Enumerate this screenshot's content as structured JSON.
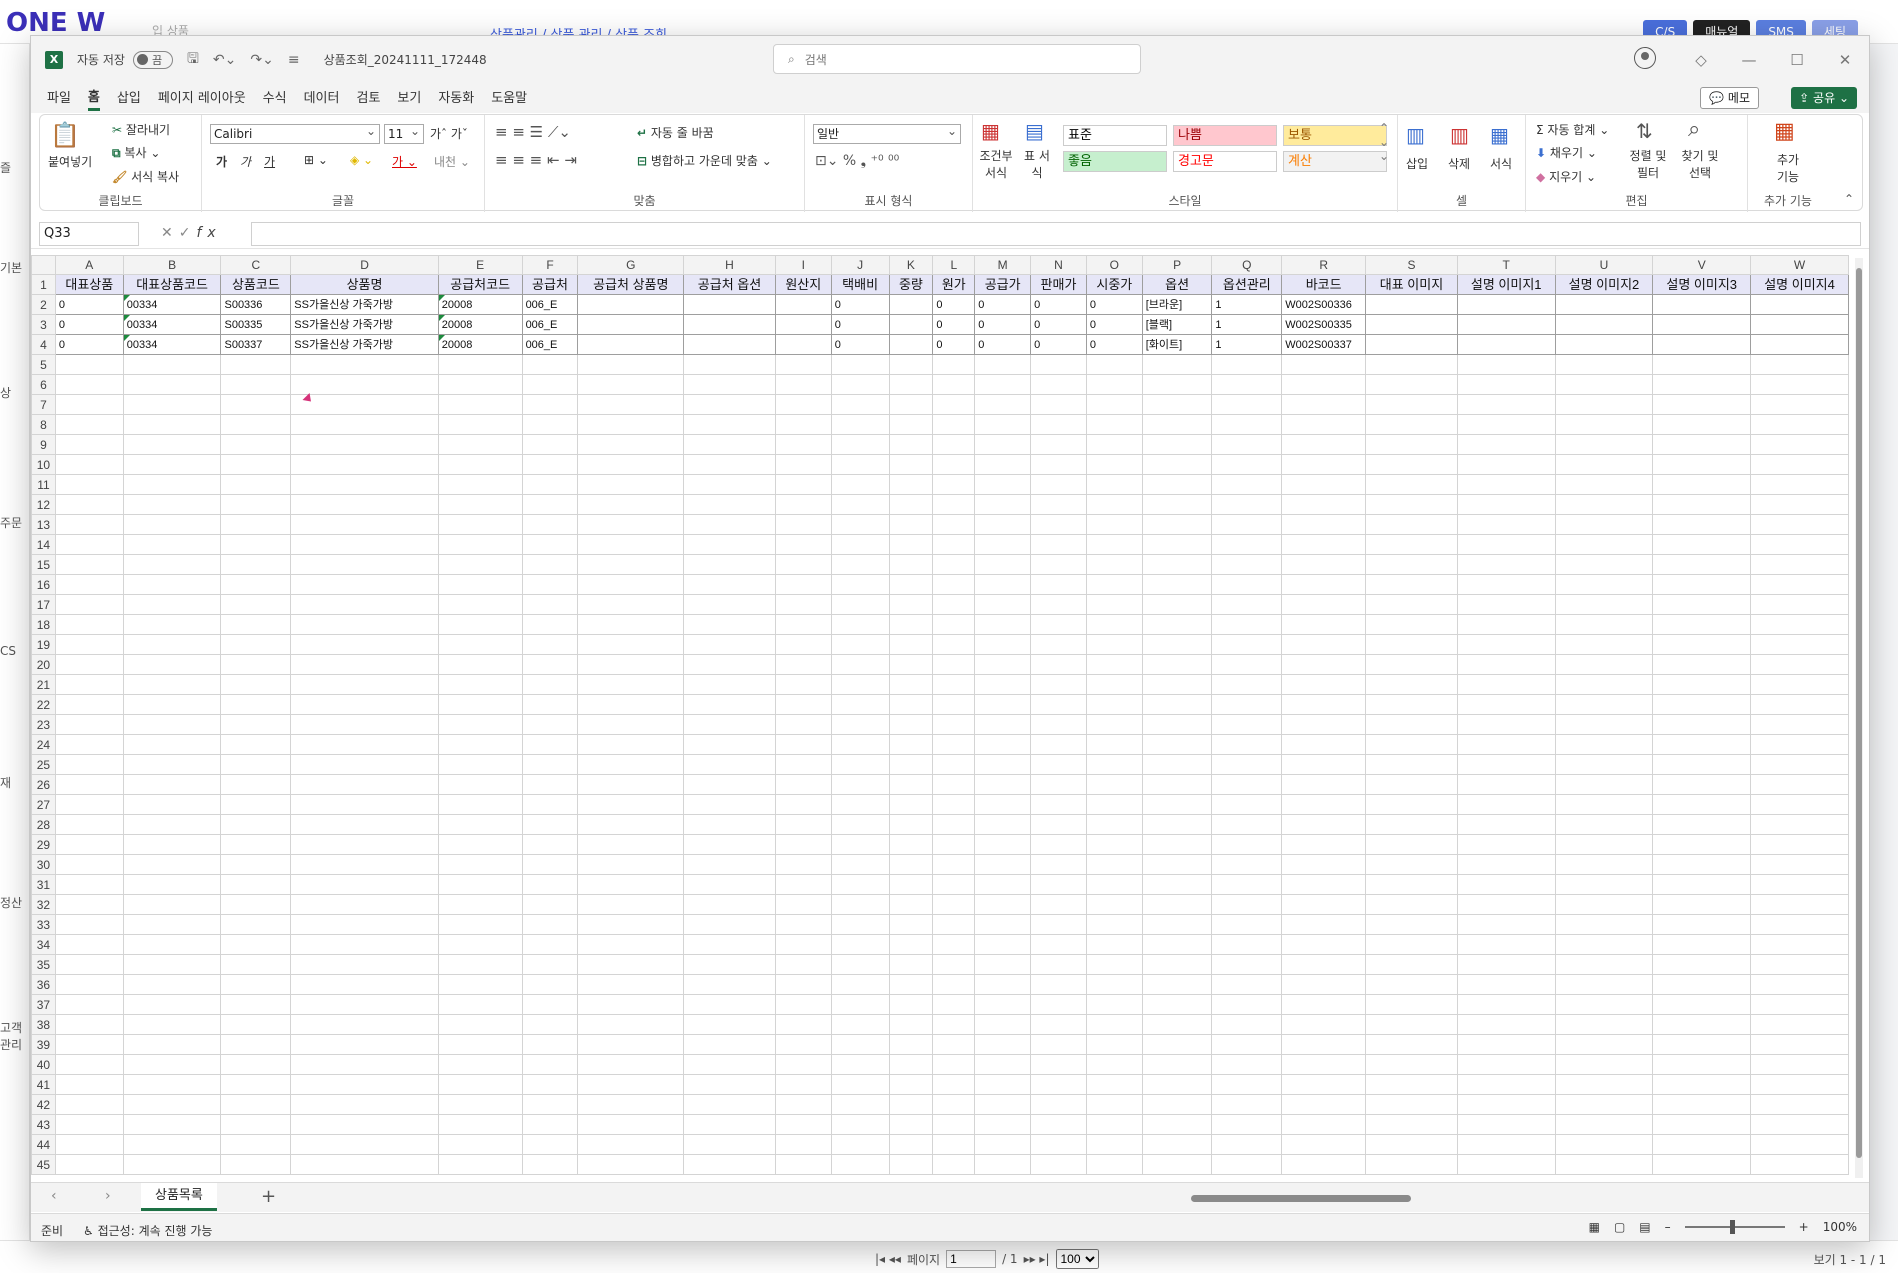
{
  "background": {
    "logo": "ONE W",
    "search_placeholder": "입 상품",
    "breadcrumb": "상품관리 / 상품 관리 / 상품 조회",
    "buttons": [
      {
        "label": "C/S",
        "color": "#4a6fdc"
      },
      {
        "label": "매뉴얼",
        "color": "#222222"
      },
      {
        "label": "SMS",
        "color": "#5b7fe0"
      },
      {
        "label": "세팅",
        "color": "#8aa0e8"
      }
    ],
    "side_labels": [
      "즐",
      "기본",
      "상",
      "주문",
      "CS",
      "재",
      "정산",
      "고객관리"
    ],
    "pager": {
      "page_label": "페이지",
      "page_value": "1",
      "of": "/ 1",
      "per_page": "100",
      "view": "보기 1 - 1 / 1"
    }
  },
  "excel": {
    "icon": "X",
    "autosave_label": "자동 저장",
    "toggle_label": "끔",
    "doc_name": "상품조회_20241111_172448",
    "search_placeholder": "검색",
    "menu": [
      "파일",
      "홈",
      "삽입",
      "페이지 레이아웃",
      "수식",
      "데이터",
      "검토",
      "보기",
      "자동화",
      "도움말"
    ],
    "active_menu": "홈",
    "memo_label": "메모",
    "share_label": "공유",
    "ribbon": {
      "clipboard": {
        "label": "클립보드",
        "paste": "붙여넣기",
        "cut": "잘라내기",
        "copy": "복사",
        "format_painter": "서식 복사"
      },
      "font": {
        "label": "글꼴",
        "font_name": "Calibri",
        "font_size": "11",
        "bold": "가",
        "italic": "가",
        "underline": "가"
      },
      "alignment": {
        "label": "맞춤",
        "wrap": "자동 줄 바꿈",
        "merge": "병합하고 가운데 맞춤"
      },
      "number": {
        "label": "표시 형식",
        "format": "일반"
      },
      "styles": {
        "label": "스타일",
        "cond_format": "조건부 서식",
        "table_format": "표 서식",
        "cells": [
          {
            "text": "표준",
            "bg": "#ffffff",
            "color": "#000000"
          },
          {
            "text": "나쁨",
            "bg": "#ffc7ce",
            "color": "#9c0006"
          },
          {
            "text": "보통",
            "bg": "#ffeb9c",
            "color": "#9c5700"
          },
          {
            "text": "좋음",
            "bg": "#c6efce",
            "color": "#006100"
          },
          {
            "text": "경고문",
            "bg": "#ffffff",
            "color": "#ff0000"
          },
          {
            "text": "계산",
            "bg": "#f2f2f2",
            "color": "#fa7d00"
          }
        ]
      },
      "cells": {
        "label": "셀",
        "insert": "삽입",
        "delete": "삭제",
        "format": "서식"
      },
      "editing": {
        "label": "편집",
        "autosum": "자동 합계",
        "fill": "채우기",
        "clear": "지우기",
        "sort": "정렬 및 필터",
        "find": "찾기 및 선택"
      },
      "addins": {
        "label": "추가 기능",
        "button": "추가 기능"
      }
    },
    "name_box": "Q33",
    "fx": "fx",
    "columns": [
      "A",
      "B",
      "C",
      "D",
      "E",
      "F",
      "G",
      "H",
      "I",
      "J",
      "K",
      "L",
      "M",
      "N",
      "O",
      "P",
      "Q",
      "R",
      "S",
      "T",
      "U",
      "V",
      "W"
    ],
    "headers": [
      "대표상품",
      "대표상품코드",
      "상품코드",
      "상품명",
      "공급처코드",
      "공급처",
      "공급처 상품명",
      "공급처 옵션",
      "원산지",
      "택배비",
      "중량",
      "원가",
      "공급가",
      "판매가",
      "시중가",
      "옵션",
      "옵션관리",
      "바코드",
      "대표 이미지",
      "설명 이미지1",
      "설명 이미지2",
      "설명 이미지3",
      "설명 이미지4"
    ],
    "rows": [
      [
        "0",
        "00334",
        "S00336",
        "SS가을신상 가죽가방",
        "20008",
        "006_E",
        "",
        "",
        "",
        "0",
        "",
        "0",
        "0",
        "0",
        "0",
        "[브라운]",
        "1",
        "W002S00336",
        "",
        "",
        "",
        "",
        ""
      ],
      [
        "0",
        "00334",
        "S00335",
        "SS가을신상 가죽가방",
        "20008",
        "006_E",
        "",
        "",
        "",
        "0",
        "",
        "0",
        "0",
        "0",
        "0",
        "[블랙]",
        "1",
        "W002S00335",
        "",
        "",
        "",
        "",
        ""
      ],
      [
        "0",
        "00334",
        "S00337",
        "SS가을신상 가죽가방",
        "20008",
        "006_E",
        "",
        "",
        "",
        "0",
        "",
        "0",
        "0",
        "0",
        "0",
        "[화이트]",
        "1",
        "W002S00337",
        "",
        "",
        "",
        "",
        ""
      ]
    ],
    "visible_row_count": 46,
    "sheet_tab": "상품목록",
    "status_ready": "준비",
    "status_accessibility": "접근성: 계속 진행 가능",
    "zoom": "100%"
  }
}
